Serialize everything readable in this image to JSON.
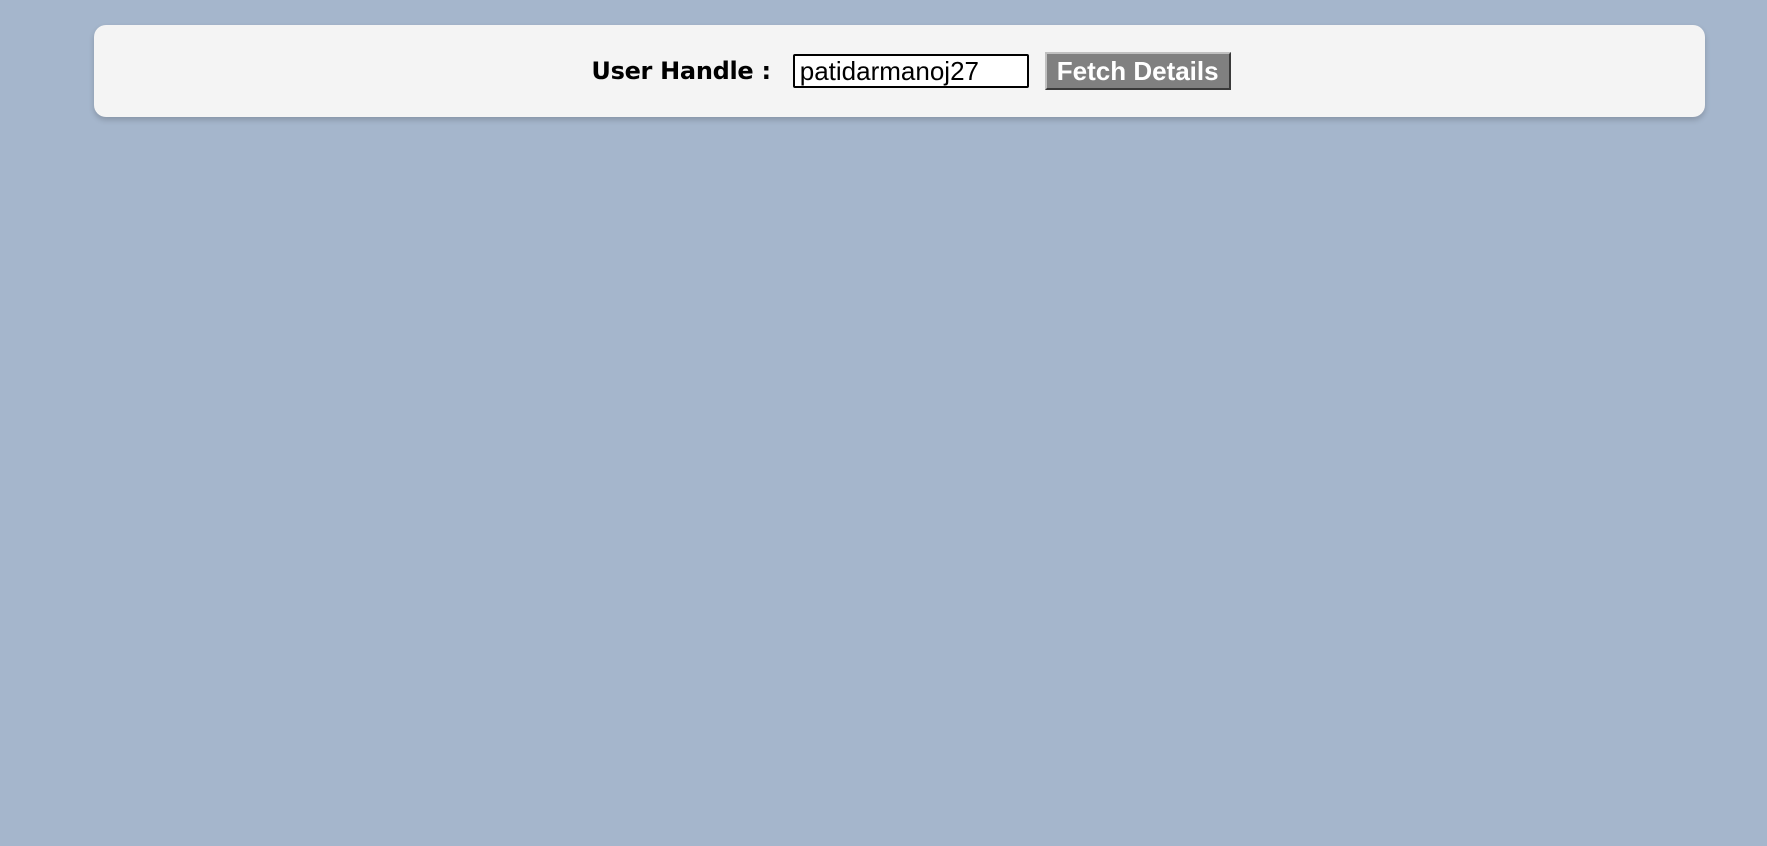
{
  "form": {
    "label": "User Handle :",
    "input_value": "patidarmanoj27",
    "button_label": "Fetch Details"
  },
  "colors": {
    "page_background": "#a5b6cc",
    "panel_background": "#f4f4f4",
    "button_background": "#808080",
    "button_text": "#ffffff"
  }
}
